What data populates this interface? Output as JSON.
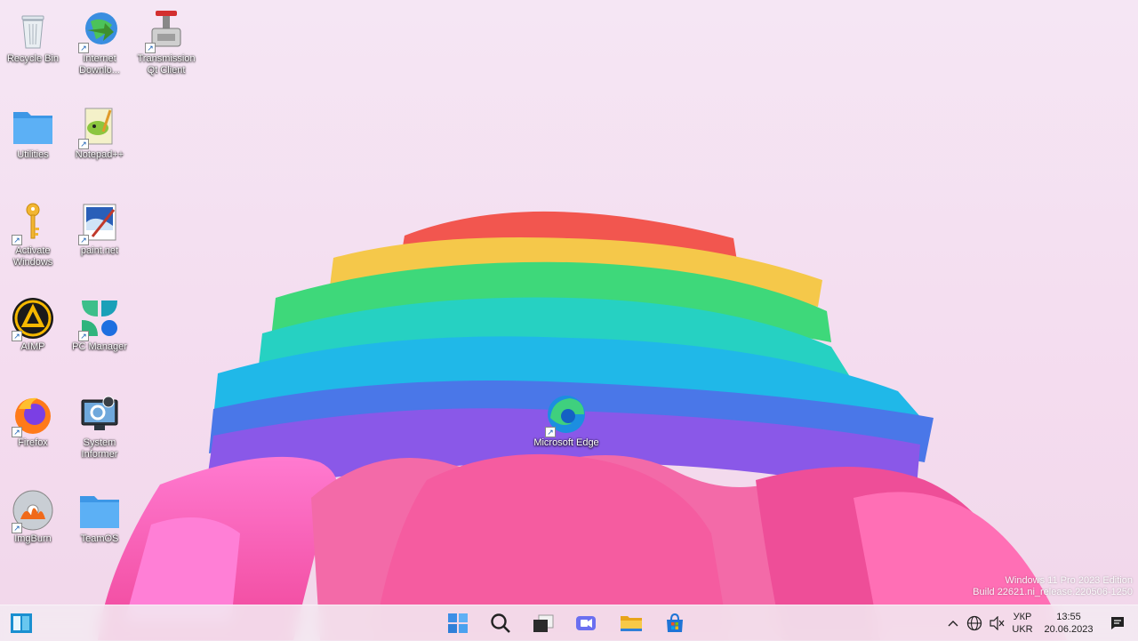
{
  "desktop": {
    "icons": [
      {
        "label": "Recycle Bin"
      },
      {
        "label": "Internet Downlo..."
      },
      {
        "label": "Transmission Qt Client"
      },
      {
        "label": "Utilities"
      },
      {
        "label": "Notepad++"
      },
      {
        "label": "Activate Windows"
      },
      {
        "label": "paint.net"
      },
      {
        "label": "AIMP"
      },
      {
        "label": "PC Manager"
      },
      {
        "label": "Firefox"
      },
      {
        "label": "System Informer"
      },
      {
        "label": "ImgBurn"
      },
      {
        "label": "TeamOS"
      },
      {
        "label": "Microsoft Edge"
      }
    ]
  },
  "watermark": {
    "line1": "Windows 11 Pro 2023 Edition",
    "line2": "Build 22621.ni_release.220506-1250"
  },
  "taskbar": {
    "items": [
      {
        "icon": "windows-start-icon"
      },
      {
        "icon": "search-icon"
      },
      {
        "icon": "task-view-icon"
      },
      {
        "icon": "teams-chat-icon"
      },
      {
        "icon": "file-explorer-icon"
      },
      {
        "icon": "microsoft-store-icon"
      }
    ],
    "tray": {
      "lang_top": "УКР",
      "lang_bottom": "UKR",
      "time": "13:55",
      "date": "20.06.2023"
    }
  },
  "colors": {
    "accent": "#0078d4",
    "folder": "#4aa3f0"
  }
}
